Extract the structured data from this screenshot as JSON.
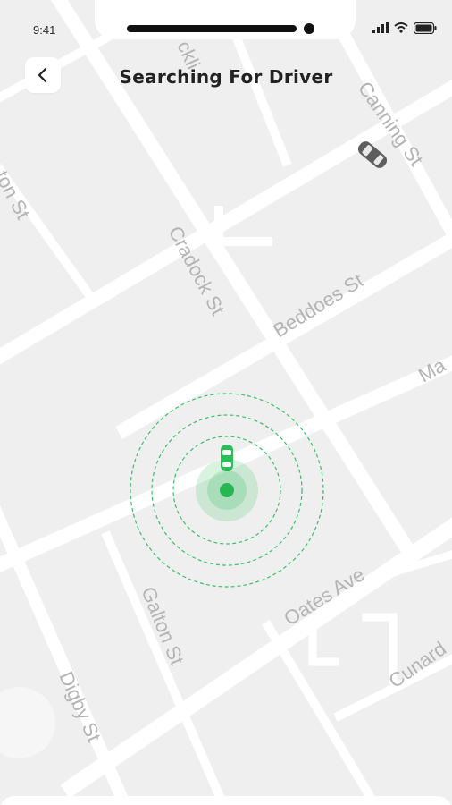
{
  "status_bar": {
    "time": "9:41"
  },
  "header": {
    "title": "Searching For Driver",
    "back_icon": "chevron-left-icon"
  },
  "map": {
    "streets": [
      "Canning St",
      "Cradock St",
      "Beddoes St",
      "Galton St",
      "Oates Ave",
      "Digby St",
      "Cunard",
      "Ma",
      "ton St",
      "ckli"
    ],
    "accent_color": "#2bbd5a",
    "search_status": "searching"
  },
  "icons": {
    "signal": "signal-icon",
    "wifi": "wifi-icon",
    "battery": "battery-icon",
    "car": "car-icon",
    "driver_car": "driver-car-icon",
    "location": "location-dot-icon"
  }
}
